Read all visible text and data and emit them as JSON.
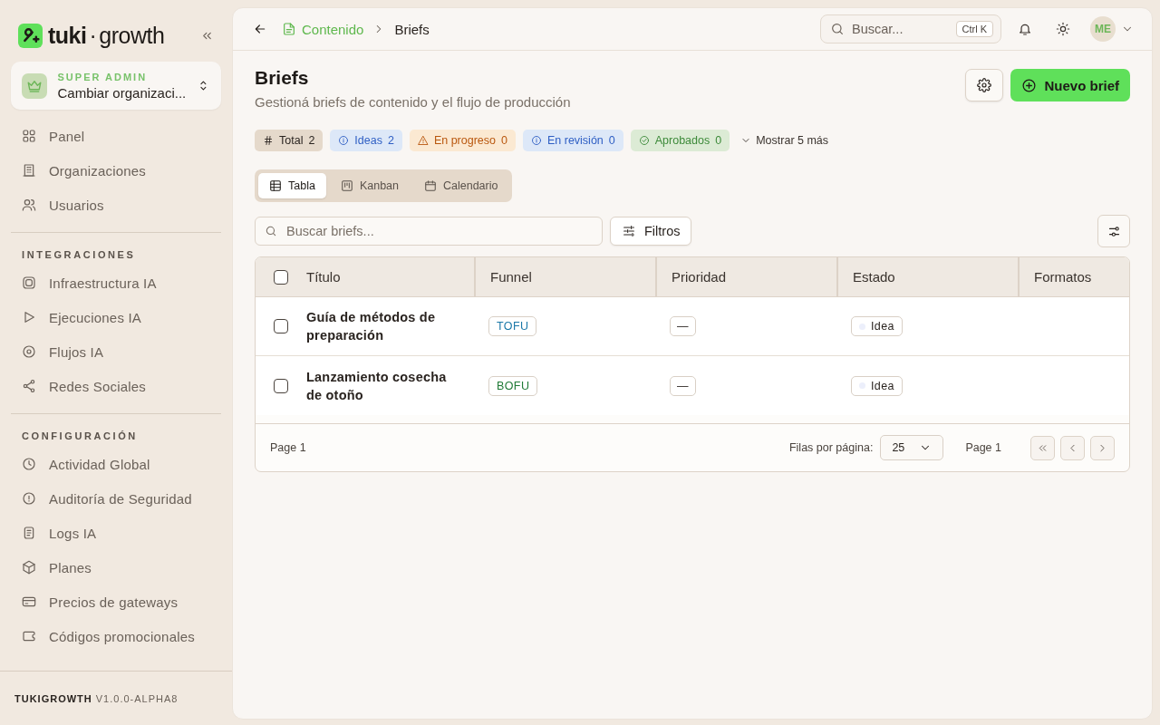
{
  "sidebar": {
    "logo": {
      "word_1": "tuki",
      "separator": "·",
      "word_2": "growth"
    },
    "org_switcher": {
      "role": "SUPER ADMIN",
      "label": "Cambiar organizaci..."
    },
    "sections": [
      {
        "items": [
          {
            "label": "Panel"
          },
          {
            "label": "Organizaciones"
          },
          {
            "label": "Usuarios"
          }
        ]
      },
      {
        "title": "INTEGRACIONES",
        "items": [
          {
            "label": "Infraestructura IA"
          },
          {
            "label": "Ejecuciones IA"
          },
          {
            "label": "Flujos IA"
          },
          {
            "label": "Redes Sociales"
          }
        ]
      },
      {
        "title": "CONFIGURACIÓN",
        "items": [
          {
            "label": "Actividad Global"
          },
          {
            "label": "Auditoría de Seguridad"
          },
          {
            "label": "Logs IA"
          },
          {
            "label": "Planes"
          },
          {
            "label": "Precios de gateways"
          },
          {
            "label": "Códigos promocionales"
          }
        ]
      }
    ],
    "footer": {
      "brand": "TUKIGROWTH",
      "version": "V1.0.0-ALPHA8"
    }
  },
  "topbar": {
    "breadcrumb": [
      {
        "label": "Contenido"
      },
      {
        "label": "Briefs"
      }
    ],
    "search": {
      "placeholder": "Buscar...",
      "shortcut": "Ctrl K"
    },
    "avatar": "ME"
  },
  "header": {
    "title": "Briefs",
    "subtitle": "Gestioná briefs de contenido y el flujo de producción",
    "primary_button": "Nuevo brief"
  },
  "stats": [
    {
      "kind": "total",
      "label": "Total",
      "count": "2"
    },
    {
      "kind": "info",
      "label": "Ideas",
      "count": "2"
    },
    {
      "kind": "warning",
      "label": "En progreso",
      "count": "0"
    },
    {
      "kind": "info",
      "label": "En revisión",
      "count": "0"
    },
    {
      "kind": "success",
      "label": "Aprobados",
      "count": "0"
    }
  ],
  "show_more": "Mostrar 5 más",
  "views": [
    {
      "label": "Tabla",
      "selected": true
    },
    {
      "label": "Kanban",
      "selected": false
    },
    {
      "label": "Calendario",
      "selected": false
    }
  ],
  "toolbar": {
    "search": {
      "placeholder": "Buscar briefs..."
    },
    "filters": "Filtros"
  },
  "table": {
    "select_all": {
      "checked": false
    },
    "columns": [
      "Título",
      "Funnel",
      "Prioridad",
      "Estado",
      "Formatos"
    ],
    "rows": [
      {
        "checked": false,
        "title": "Guía de métodos de preparación",
        "funnel": {
          "label": "TOFU",
          "color": "#1a78a8"
        },
        "priority": "—",
        "status": {
          "label": "Idea",
          "color": "#eceffb"
        }
      },
      {
        "checked": false,
        "title": "Lanzamiento cosecha de otoño",
        "funnel": {
          "label": "BOFU",
          "color": "#1f7a36"
        },
        "priority": "—",
        "status": {
          "label": "Idea",
          "color": "#eceffb"
        }
      }
    ],
    "footer": {
      "page": "Page 1",
      "rows_label": "Filas por página:",
      "rows_value": "25",
      "page_right": "Page 1"
    }
  }
}
